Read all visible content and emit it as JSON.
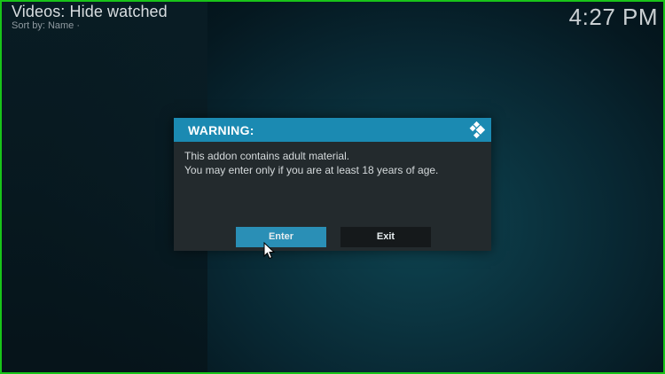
{
  "header": {
    "title": "Videos: Hide watched",
    "sort": "Sort by: Name  ·",
    "clock": "4:27 PM"
  },
  "dialog": {
    "title": "WARNING:",
    "logo_icon": "kodi-logo-icon",
    "message_line1": "This addon contains adult material.",
    "message_line2": "You may enter only if you are at least 18 years of age.",
    "enter_label": "Enter",
    "exit_label": "Exit"
  },
  "colors": {
    "accent": "#1b8ab2",
    "focused_button": "#2a8fb6",
    "dialog_bg": "#232a2d",
    "frame": "#19c419"
  }
}
